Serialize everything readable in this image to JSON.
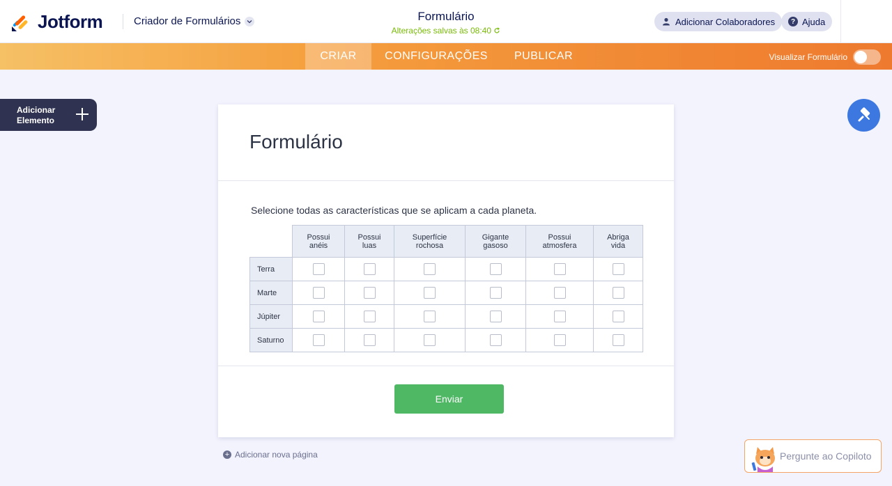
{
  "header": {
    "logo_text": "Jotform",
    "builder_label": "Criador de Formulários",
    "form_name": "Formulário",
    "saved_status": "Alterações salvas às 08:40",
    "add_collaborators": "Adicionar Colaboradores",
    "help": "Ajuda"
  },
  "nav": {
    "tabs": [
      "CRIAR",
      "CONFIGURAÇÕES",
      "PUBLICAR"
    ],
    "active_tab": "CRIAR",
    "preview_label": "Visualizar Formulário",
    "preview_enabled": false
  },
  "sidebar": {
    "add_element_line1": "Adicionar",
    "add_element_line2": "Elemento"
  },
  "form": {
    "title": "Formulário",
    "question": "Selecione todas as características que se aplicam a cada planeta.",
    "matrix": {
      "columns": [
        [
          "Possui",
          "anéis"
        ],
        [
          "Possui",
          "luas"
        ],
        [
          "Superfície",
          "rochosa"
        ],
        [
          "Gigante",
          "gasoso"
        ],
        [
          "Possui",
          "atmosfera"
        ],
        [
          "Abriga",
          "vida"
        ]
      ],
      "rows": [
        "Terra",
        "Marte",
        "Júpiter",
        "Saturno"
      ]
    },
    "submit_label": "Enviar"
  },
  "footer": {
    "add_page": "Adicionar nova página",
    "copilot": "Pergunte ao Copiloto"
  },
  "colors": {
    "brand_navy": "#0a1551",
    "submit_green": "#4fb864",
    "nav_orange": "#f18a35",
    "paint_blue": "#3c78e0"
  }
}
